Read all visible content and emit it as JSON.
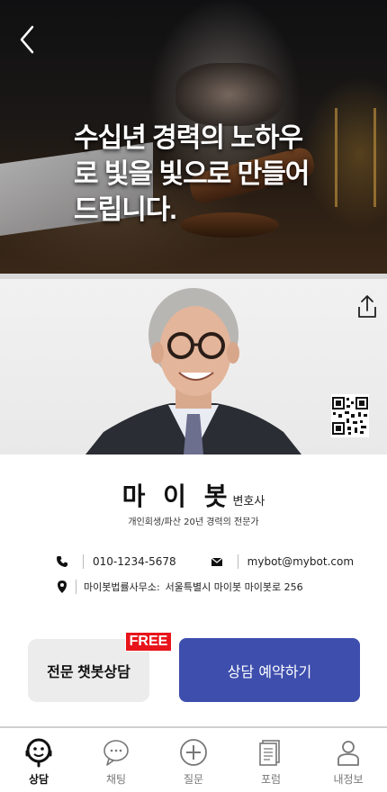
{
  "hero": {
    "lines": [
      "수십년 경력의 노하우",
      "로 빛을 빛으로 만들어",
      "드립니다."
    ]
  },
  "profile": {
    "name": "마 이 봇",
    "title": "변호사",
    "subtitle": "개인회생/파산 20년 경력의 전문가",
    "phone": "010-1234-5678",
    "email": "mybot@mybot.com",
    "address_label": "마이봇법률사무소:",
    "address": "서울특별시 마이봇 마이봇로 256"
  },
  "actions": {
    "chatbot_label": "전문 챗봇상담",
    "free_badge": "FREE",
    "book_label": "상담 예약하기"
  },
  "tabs": [
    {
      "label": "상담",
      "icon": "consult-icon",
      "active": true
    },
    {
      "label": "채팅",
      "icon": "chat-icon",
      "active": false
    },
    {
      "label": "질문",
      "icon": "plus-circle-icon",
      "active": false
    },
    {
      "label": "포럼",
      "icon": "document-icon",
      "active": false
    },
    {
      "label": "내정보",
      "icon": "person-icon",
      "active": false
    }
  ],
  "colors": {
    "primary": "#3d4ead",
    "free_badge": "#e8141b",
    "chatbot_bg": "#ececec"
  }
}
